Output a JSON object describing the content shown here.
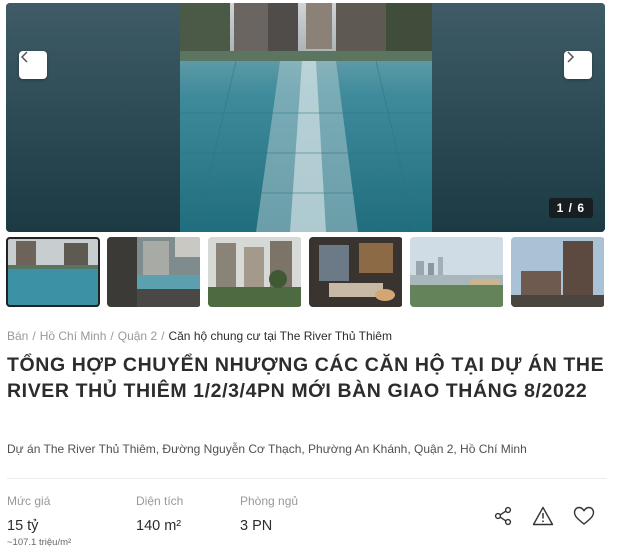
{
  "gallery": {
    "counter": "1 / 6",
    "thumbnails": [
      {
        "name": "pool",
        "active": true
      },
      {
        "name": "pool-deck"
      },
      {
        "name": "towers-garden"
      },
      {
        "name": "living-room"
      },
      {
        "name": "river-view"
      },
      {
        "name": "tower-exterior"
      }
    ]
  },
  "breadcrumb": {
    "items": [
      "Bán",
      "Hồ Chí Minh",
      "Quận 2"
    ],
    "separator": "/",
    "current": "Căn hộ chung cư tại The River Thủ Thiêm"
  },
  "listing": {
    "title": "TỔNG HỢP CHUYỂN NHƯỢNG CÁC CĂN HỘ TẠI DỰ ÁN THE RIVER THỦ THIÊM 1/2/3/4PN MỚI BÀN GIAO THÁNG 8/2022",
    "address": "Dự án The River Thủ Thiêm, Đường Nguyễn Cơ Thạch, Phường An Khánh, Quận 2, Hồ Chí Minh"
  },
  "stats": {
    "price": {
      "label": "Mức giá",
      "value": "15 tỷ",
      "sub": "~107.1 triệu/m²"
    },
    "area": {
      "label": "Diện tích",
      "value": "140 m²"
    },
    "bedrooms": {
      "label": "Phòng ngủ",
      "value": "3 PN"
    }
  },
  "actions": {
    "icons": [
      "share-icon",
      "warning-icon",
      "heart-icon"
    ]
  }
}
